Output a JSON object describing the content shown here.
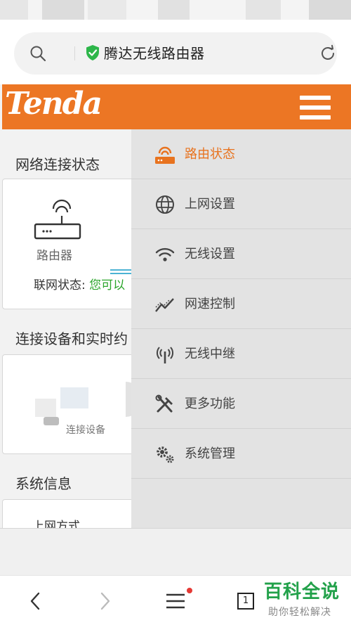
{
  "browser": {
    "address_title": "腾达无线路由器",
    "tabs_count": "1"
  },
  "brand": {
    "logo_text": "Tenda",
    "header_color": "#ec7624",
    "accent_color": "#e8731f"
  },
  "content": {
    "network_section_title": "网络连接状态",
    "router_label": "路由器",
    "net_status_label": "联网状态:",
    "net_status_value": "您可以",
    "devices_section_title": "连接设备和实时约",
    "devices_label": "连接设备",
    "system_section_title": "系统信息",
    "system_sub_label": "上网方式"
  },
  "menu": {
    "items": [
      {
        "label": "路由状态",
        "icon": "router-status-icon",
        "active": true
      },
      {
        "label": "上网设置",
        "icon": "globe-icon",
        "active": false
      },
      {
        "label": "无线设置",
        "icon": "wifi-icon",
        "active": false
      },
      {
        "label": "网速控制",
        "icon": "speed-chart-icon",
        "active": false
      },
      {
        "label": "无线中继",
        "icon": "antenna-icon",
        "active": false
      },
      {
        "label": "更多功能",
        "icon": "tools-icon",
        "active": false
      },
      {
        "label": "系统管理",
        "icon": "gears-icon",
        "active": false
      }
    ]
  },
  "watermark": {
    "title": "百科全说",
    "subtitle": "助你轻松解决"
  }
}
